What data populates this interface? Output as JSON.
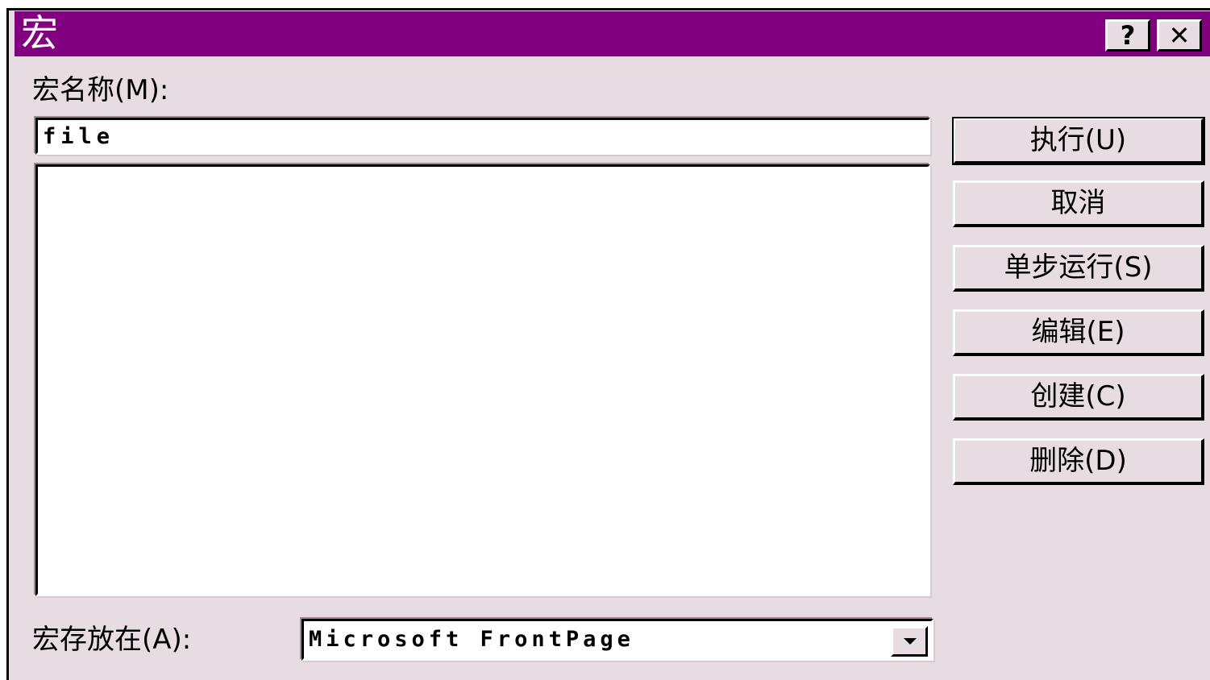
{
  "window": {
    "title": "宏",
    "help_label": "?",
    "close_label": "✕"
  },
  "macro_name": {
    "label": "宏名称(M):",
    "value": "file"
  },
  "macro_list": {
    "items": []
  },
  "buttons": {
    "run": "执行(U)",
    "cancel": "取消",
    "step": "单步运行(S)",
    "edit": "编辑(E)",
    "create": "创建(C)",
    "delete": "删除(D)"
  },
  "macros_in": {
    "label": "宏存放在(A):",
    "selected": "Microsoft FrontPage"
  },
  "colors": {
    "title_bar": "#800080",
    "dialog_bg": "#e8dce3"
  },
  "icons": {
    "help": "help-icon",
    "close": "close-icon",
    "dropdown": "chevron-down-icon"
  }
}
